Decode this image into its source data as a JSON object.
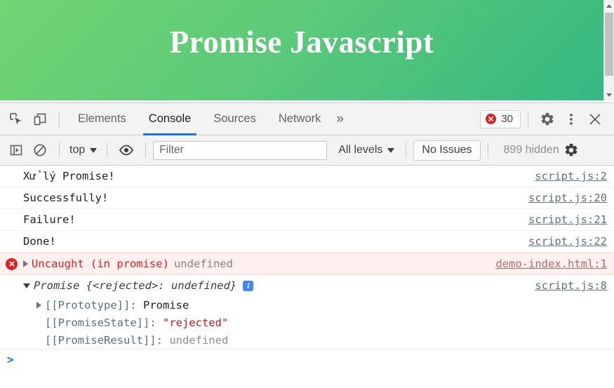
{
  "page": {
    "title": "Promise Javascript",
    "gradient_from": "#72d572",
    "gradient_to": "#34b882",
    "scrollbar": {
      "up_arrow": "scroll-up-arrow",
      "down_arrow": "scroll-down-arrow"
    }
  },
  "devtools": {
    "tabbar": {
      "inspect_icon": "inspect-element-icon",
      "device_icon": "device-toolbar-icon",
      "tabs": [
        {
          "label": "Elements",
          "active": false
        },
        {
          "label": "Console",
          "active": true
        },
        {
          "label": "Sources",
          "active": false
        },
        {
          "label": "Network",
          "active": false
        }
      ],
      "more_tabs_label": "»",
      "error_badge": {
        "icon": "error-icon",
        "count": "30"
      },
      "settings_icon": "gear-icon",
      "menu_icon": "kebab-menu-icon",
      "close_icon": "close-icon"
    },
    "console_toolbar": {
      "sidebar_icon": "console-sidebar-icon",
      "clear_icon": "clear-console-icon",
      "context": "top",
      "eye_icon": "live-expression-icon",
      "filter_placeholder": "Filter",
      "filter_value": "",
      "levels": "All levels",
      "issues_label": "No Issues",
      "hidden_label": "899 hidden",
      "settings_icon": "console-settings-gear-icon"
    },
    "messages": [
      {
        "text": "Xử lý Promise!",
        "source": "script.js:2"
      },
      {
        "text": "Successfully!",
        "source": "script.js:20"
      },
      {
        "text": "Failure!",
        "source": "script.js:21"
      },
      {
        "text": "Done!",
        "source": "script.js:22"
      }
    ],
    "error": {
      "icon": "error-icon",
      "expander": "expand-arrow-right-icon",
      "message": "Uncaught (in promise)",
      "value": "undefined",
      "source": "demo-index.html:1"
    },
    "object_tree": {
      "expander": "collapse-arrow-down-icon",
      "header_name": "Promise ",
      "header_preview": "{<rejected>: undefined}",
      "info_badge": "info-icon",
      "source": "script.js:8",
      "rows": [
        {
          "expander": "expand-arrow-right-icon",
          "name": "[[Prototype]]",
          "sep": ": ",
          "value": "Promise",
          "value_kind": "plain"
        },
        {
          "expander": "",
          "name": "[[PromiseState]]",
          "sep": ": ",
          "value": "\"rejected\"",
          "value_kind": "string"
        },
        {
          "expander": "",
          "name": "[[PromiseResult]]",
          "sep": ": ",
          "value": "undefined",
          "value_kind": "undef"
        }
      ]
    },
    "prompt": {
      "caret": ">"
    }
  }
}
